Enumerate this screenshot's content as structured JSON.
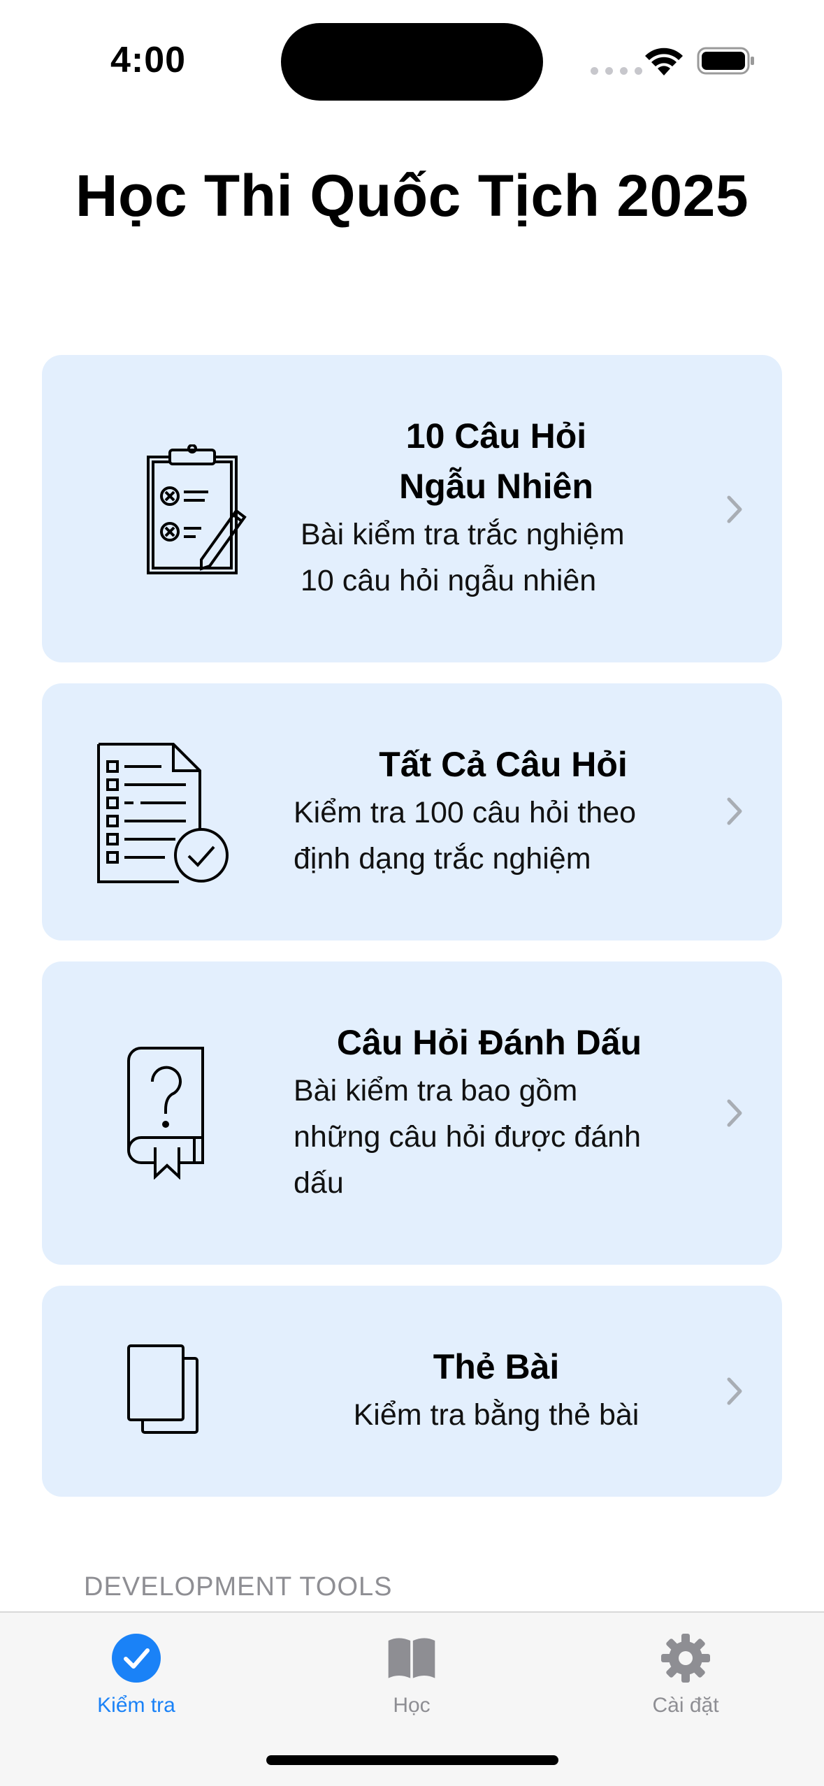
{
  "status_bar": {
    "time": "4:00"
  },
  "page_title": "Học Thi Quốc Tịch 2025",
  "cards": [
    {
      "title_line1": "10 Câu Hỏi",
      "title_line2": "Ngẫu Nhiên",
      "desc_line1": "Bài kiểm tra trắc nghiệm",
      "desc_line2": "10 câu hỏi ngẫu nhiên",
      "icon": "clipboard-pencil-icon"
    },
    {
      "title": "Tất Cả Câu Hỏi",
      "desc_line1": "Kiểm tra 100 câu hỏi theo",
      "desc_line2": "định dạng trắc nghiệm",
      "icon": "checklist-document-icon"
    },
    {
      "title": "Câu Hỏi Đánh Dấu",
      "desc_line1": "Bài kiểm tra bao gồm",
      "desc_line2": "những câu hỏi được đánh",
      "desc_line3": "dấu",
      "icon": "question-book-icon"
    },
    {
      "title": "Thẻ Bài",
      "desc_line1": "Kiểm tra bằng thẻ bài",
      "icon": "cards-icon"
    }
  ],
  "section_header": "DEVELOPMENT TOOLS",
  "tab_bar": {
    "tabs": [
      {
        "label": "Kiểm tra",
        "icon": "checkmark-circle-icon",
        "active": true
      },
      {
        "label": "Học",
        "icon": "book-icon",
        "active": false
      },
      {
        "label": "Cài đặt",
        "icon": "gear-icon",
        "active": false
      }
    ]
  },
  "colors": {
    "card_bg": "#e3effd",
    "accent": "#1a82f7",
    "inactive": "#8e8e93"
  }
}
